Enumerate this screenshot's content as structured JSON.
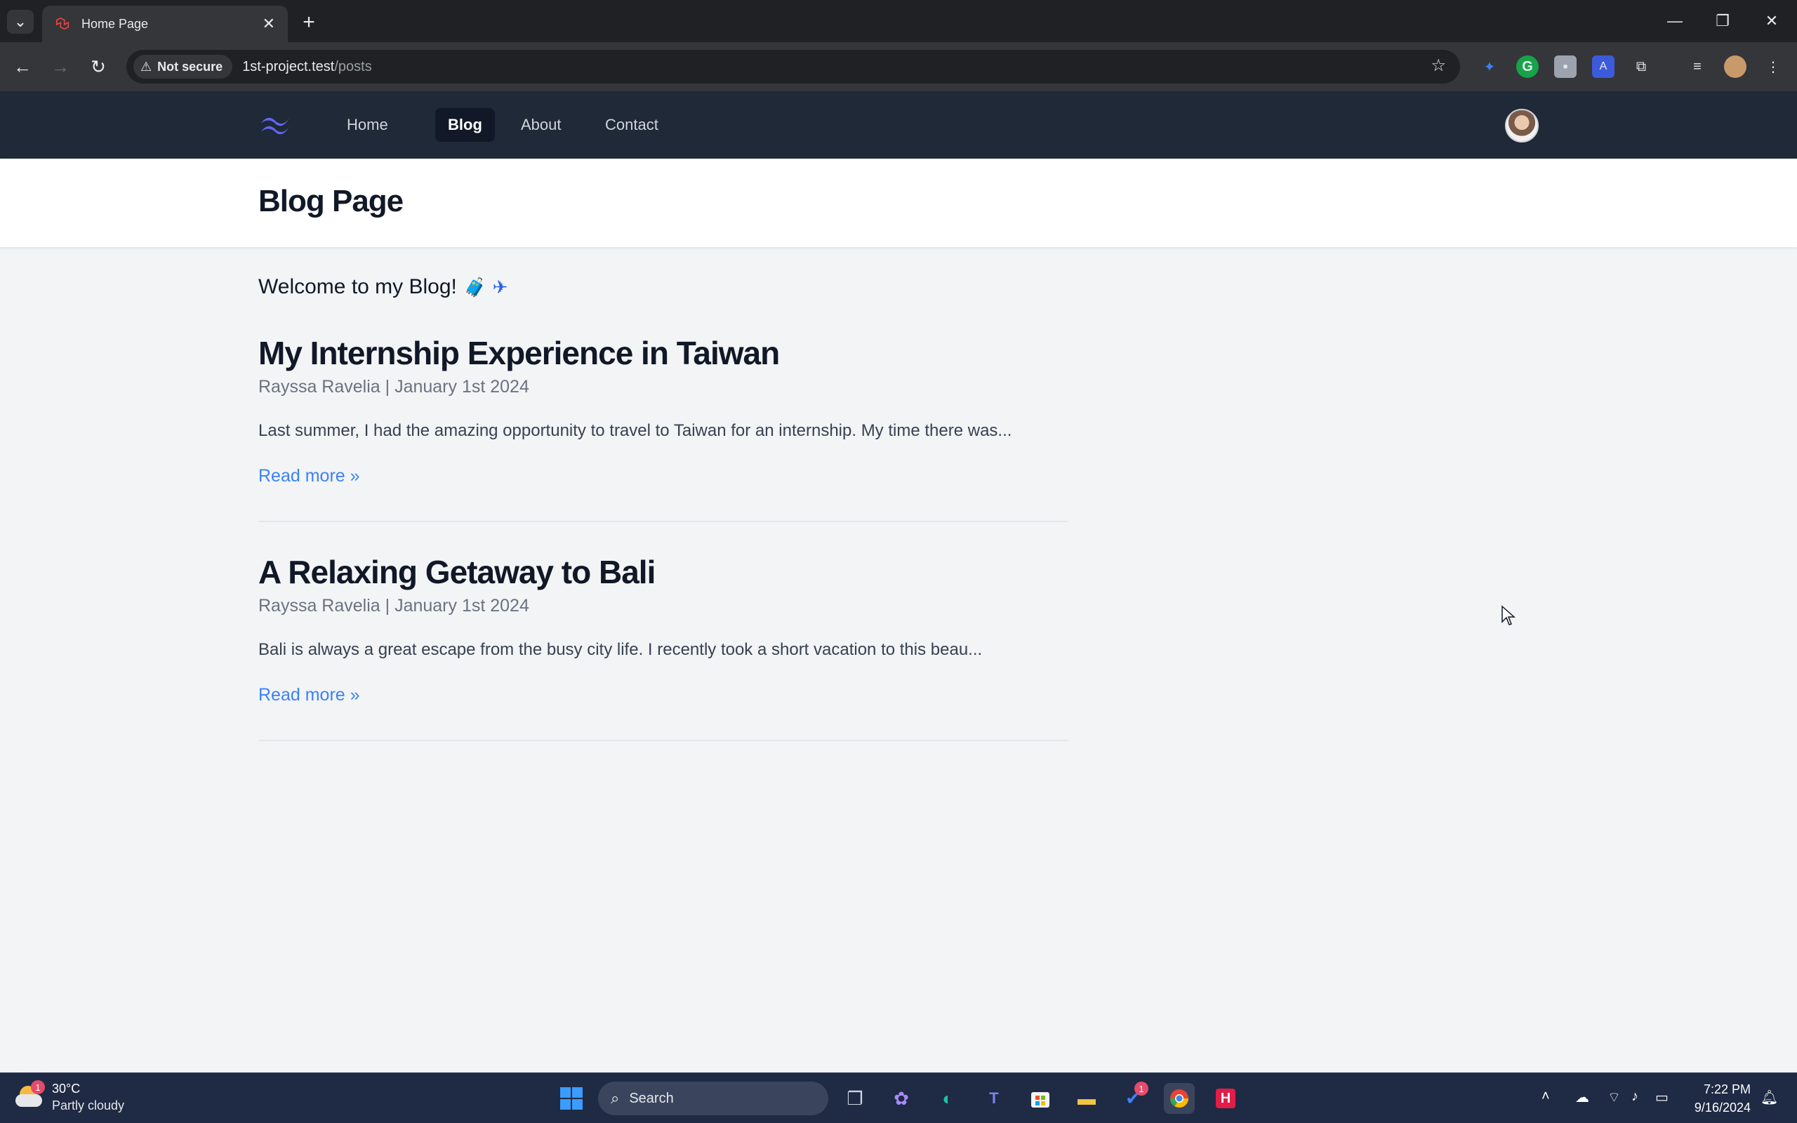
{
  "browser": {
    "tab_title": "Home Page",
    "security_label": "Not secure",
    "url_host": "1st-project.test",
    "url_path": "/posts"
  },
  "site": {
    "nav": [
      {
        "label": "Home"
      },
      {
        "label": "Blog",
        "active": true
      },
      {
        "label": "About"
      },
      {
        "label": "Contact"
      }
    ],
    "brand_color": "#6366f1",
    "nav_bg": "#1f2937"
  },
  "header": {
    "title": "Blog Page"
  },
  "main": {
    "welcome": "Welcome to my Blog!",
    "welcome_emoji": "🧳 ✈",
    "posts": [
      {
        "title": "My Internship Experience in Taiwan",
        "meta": "Rayssa Ravelia | January 1st 2024",
        "excerpt": "Last summer, I had the amazing opportunity to travel to Taiwan for an internship. My time there was...",
        "read_more": "Read more »"
      },
      {
        "title": "A Relaxing Getaway to Bali",
        "meta": "Rayssa Ravelia | January 1st 2024",
        "excerpt": "Bali is always a great escape from the busy city life. I recently took a short vacation to this beau...",
        "read_more": "Read more »"
      }
    ]
  },
  "taskbar": {
    "weather_temp": "30°C",
    "weather_cond": "Partly cloudy",
    "weather_badge": "1",
    "search_placeholder": "Search",
    "todo_badge": "1",
    "time": "7:22 PM",
    "date": "9/16/2024"
  }
}
